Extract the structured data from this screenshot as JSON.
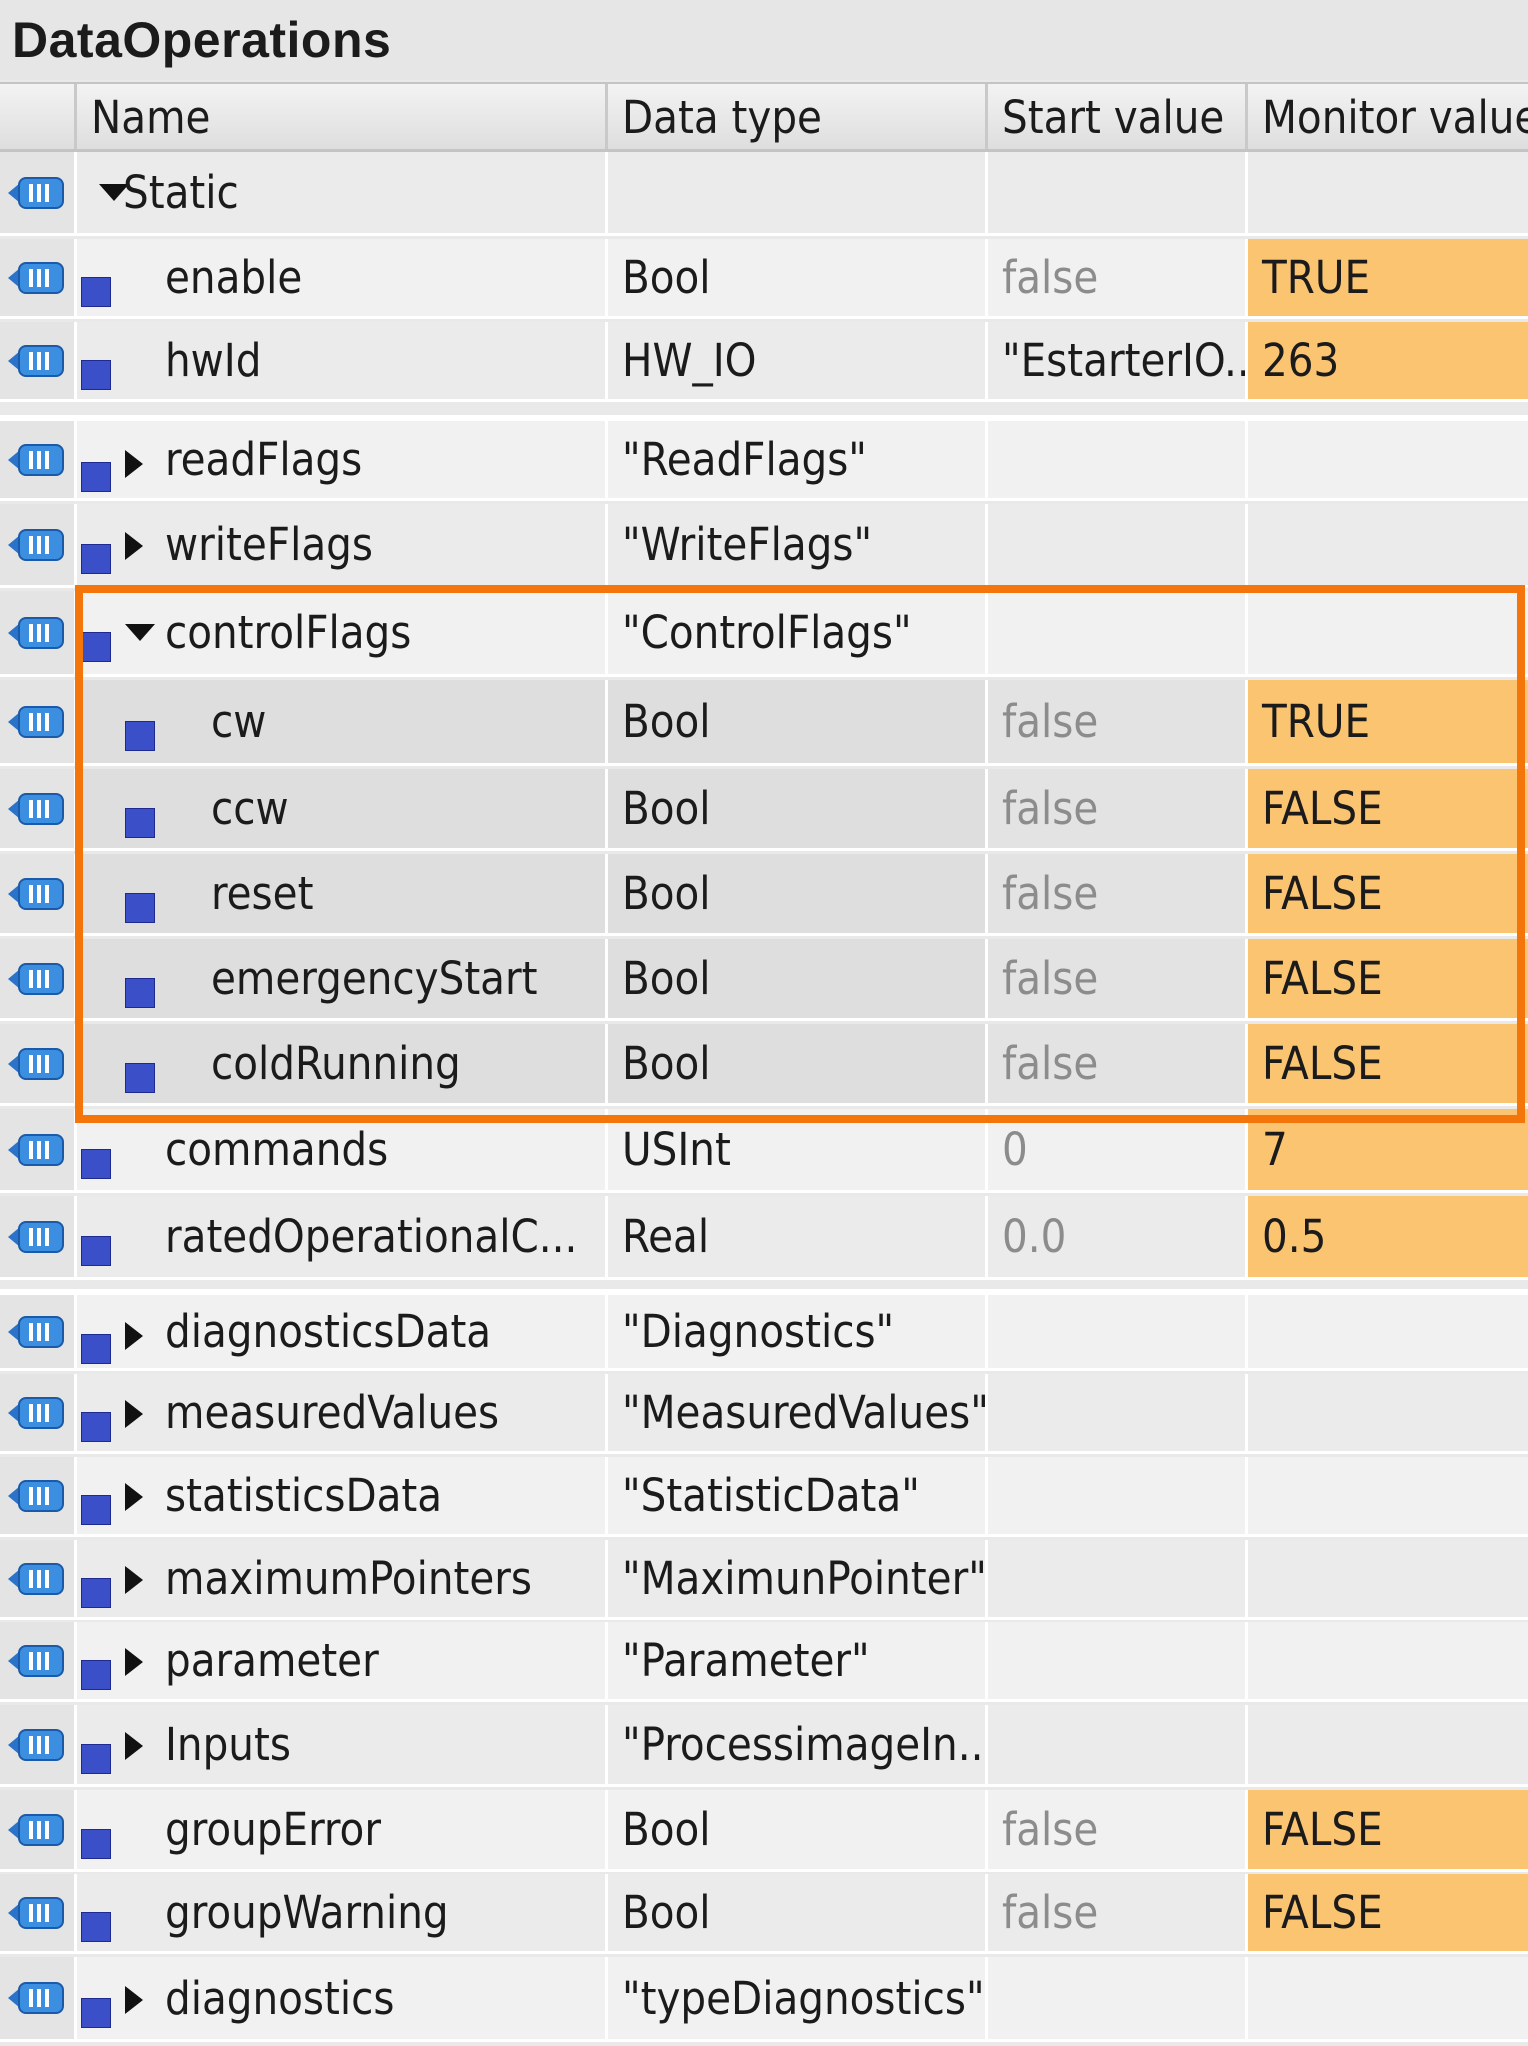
{
  "window": {
    "title": "DataOperations"
  },
  "columns": {
    "name": "Name",
    "data_type": "Data type",
    "start_value": "Start value",
    "monitor_value": "Monitor value"
  },
  "colors": {
    "monitor_active": "#fbc471",
    "highlight_border": "#f4760b",
    "tag_icon": "#3b4fc8"
  },
  "rows": [
    {
      "name": "Static",
      "type": "",
      "start": "",
      "monitor": "",
      "expander": "down"
    },
    {
      "name": "enable",
      "type": "Bool",
      "start": "false",
      "monitor": "TRUE",
      "expander": ""
    },
    {
      "name": "hwId",
      "type": "HW_IO",
      "start": "\"EstarterIO...",
      "monitor": "263",
      "expander": ""
    },
    {
      "name": "readFlags",
      "type": "\"ReadFlags\"",
      "start": "",
      "monitor": "",
      "expander": "right"
    },
    {
      "name": "writeFlags",
      "type": "\"WriteFlags\"",
      "start": "",
      "monitor": "",
      "expander": "right"
    },
    {
      "name": "controlFlags",
      "type": "\"ControlFlags\"",
      "start": "",
      "monitor": "",
      "expander": "down"
    },
    {
      "name": "cw",
      "type": "Bool",
      "start": "false",
      "monitor": "TRUE",
      "expander": ""
    },
    {
      "name": "ccw",
      "type": "Bool",
      "start": "false",
      "monitor": "FALSE",
      "expander": ""
    },
    {
      "name": "reset",
      "type": "Bool",
      "start": "false",
      "monitor": "FALSE",
      "expander": ""
    },
    {
      "name": "emergencyStart",
      "type": "Bool",
      "start": "false",
      "monitor": "FALSE",
      "expander": ""
    },
    {
      "name": "coldRunning",
      "type": "Bool",
      "start": "false",
      "monitor": "FALSE",
      "expander": ""
    },
    {
      "name": "commands",
      "type": "USInt",
      "start": "0",
      "monitor": "7",
      "expander": ""
    },
    {
      "name": "ratedOperationalC...",
      "type": "Real",
      "start": "0.0",
      "monitor": "0.5",
      "expander": ""
    },
    {
      "name": "diagnosticsData",
      "type": "\"Diagnostics\"",
      "start": "",
      "monitor": "",
      "expander": "right"
    },
    {
      "name": "measuredValues",
      "type": "\"MeasuredValues\"",
      "start": "",
      "monitor": "",
      "expander": "right"
    },
    {
      "name": "statisticsData",
      "type": "\"StatisticData\"",
      "start": "",
      "monitor": "",
      "expander": "right"
    },
    {
      "name": "maximumPointers",
      "type": "\"MaximunPointer\"",
      "start": "",
      "monitor": "",
      "expander": "right"
    },
    {
      "name": "parameter",
      "type": "\"Parameter\"",
      "start": "",
      "monitor": "",
      "expander": "right"
    },
    {
      "name": "Inputs",
      "type": "\"ProcessimageIn...",
      "start": "",
      "monitor": "",
      "expander": "right"
    },
    {
      "name": "groupError",
      "type": "Bool",
      "start": "false",
      "monitor": "FALSE",
      "expander": ""
    },
    {
      "name": "groupWarning",
      "type": "Bool",
      "start": "false",
      "monitor": "FALSE",
      "expander": ""
    },
    {
      "name": "diagnostics",
      "type": "\"typeDiagnostics\"",
      "start": "",
      "monitor": "",
      "expander": "right"
    }
  ]
}
